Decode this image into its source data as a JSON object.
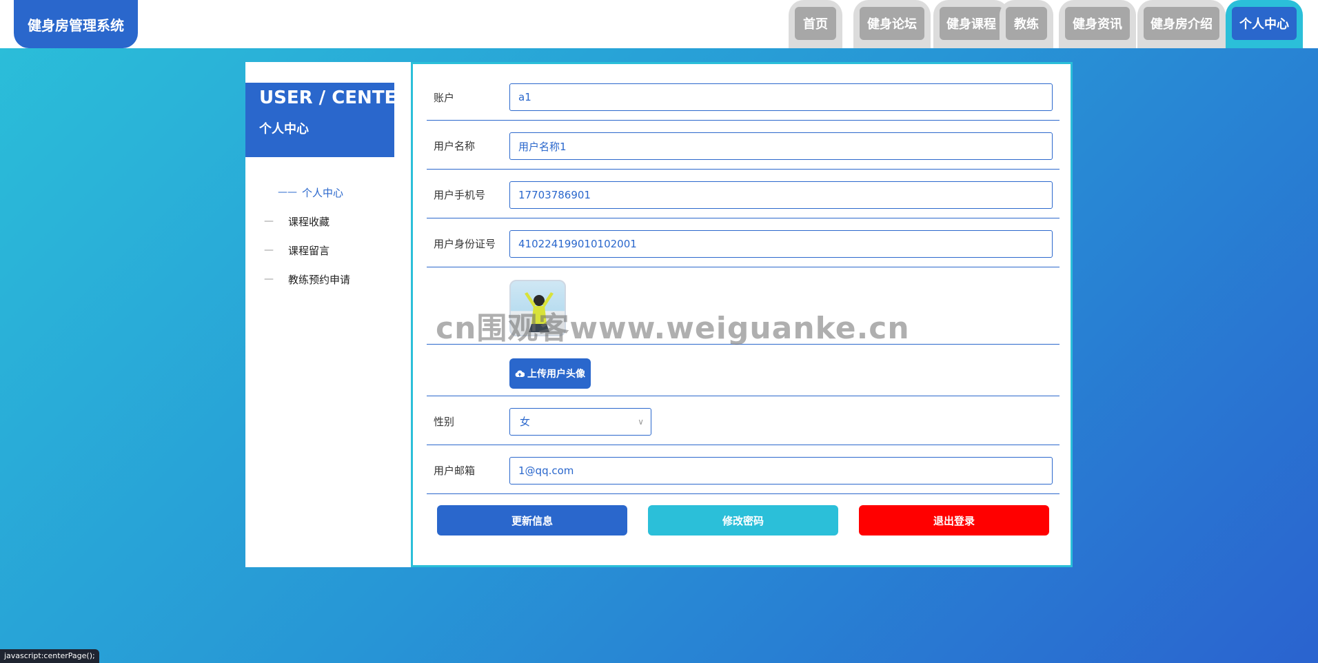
{
  "header": {
    "brand": "健身房管理系统",
    "nav": [
      {
        "label": "首页",
        "active": false
      },
      {
        "label": "健身论坛",
        "active": false
      },
      {
        "label": "健身课程",
        "active": false
      },
      {
        "label": "教练",
        "active": false
      },
      {
        "label": "健身资讯",
        "active": false
      },
      {
        "label": "健身房介绍",
        "active": false
      },
      {
        "label": "个人中心",
        "active": true
      }
    ]
  },
  "sidebar": {
    "title_en": "USER / CENTER",
    "title_cn": "个人中心",
    "items": [
      {
        "label": "个人中心",
        "active": true
      },
      {
        "label": "课程收藏",
        "active": false
      },
      {
        "label": "课程留言",
        "active": false
      },
      {
        "label": "教练预约申请",
        "active": false
      }
    ]
  },
  "form": {
    "account": {
      "label": "账户",
      "value": "a1"
    },
    "username": {
      "label": "用户名称",
      "value": "用户名称1"
    },
    "phone": {
      "label": "用户手机号",
      "value": "17703786901"
    },
    "idcard": {
      "label": "用户身份证号",
      "value": "410224199010102001"
    },
    "upload_label": "上传用户头像",
    "gender": {
      "label": "性别",
      "value": "女"
    },
    "email": {
      "label": "用户邮箱",
      "value": "1@qq.com"
    }
  },
  "actions": {
    "update": "更新信息",
    "change_password": "修改密码",
    "logout": "退出登录"
  },
  "colors": {
    "primary": "#2a67cc",
    "accent": "#2bbfd9",
    "danger": "#ff0000",
    "nav_inactive": "#a7a7a7"
  },
  "watermark": "cn围观客www.weiguanke.cn",
  "status": "javascript:centerPage();"
}
